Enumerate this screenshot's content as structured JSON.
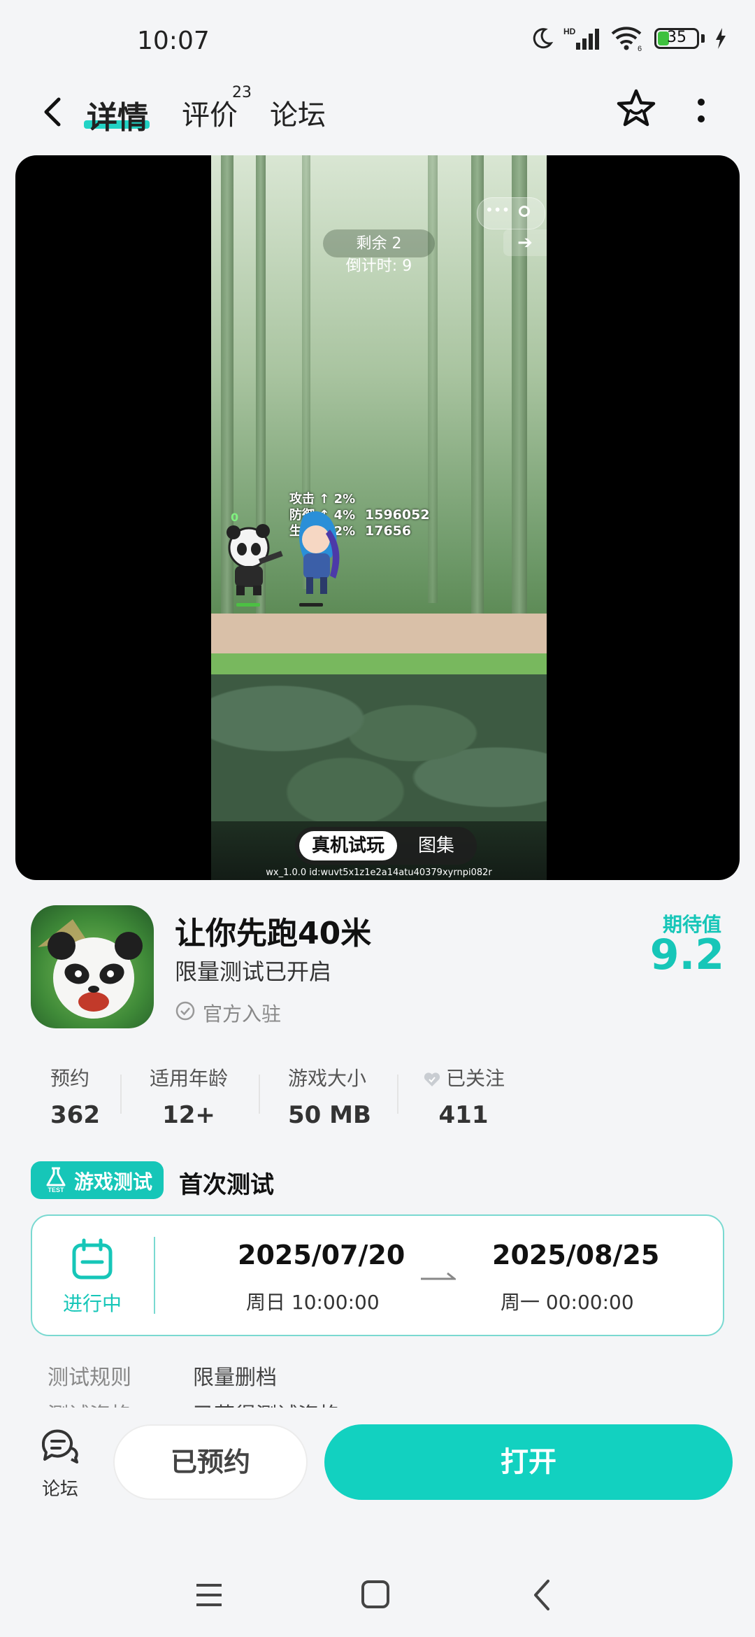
{
  "status_bar": {
    "time": "10:07",
    "battery": "35",
    "battery_level": 0.35,
    "network": "HD",
    "wifi_sub": "6"
  },
  "nav": {
    "tabs": [
      {
        "label": "详情",
        "active": true
      },
      {
        "label": "评价",
        "badge": "23"
      },
      {
        "label": "论坛"
      }
    ]
  },
  "media": {
    "hud_remaining": "剩余 2",
    "hud_countdown": "倒计时: 9",
    "stats": [
      "攻击 ↑ 2%",
      "防御 ↑ 4%",
      "生命 ↑ 2%"
    ],
    "power_values": [
      "1596052",
      "17656"
    ],
    "player_level": "0",
    "toggle_trial": "真机试玩",
    "toggle_gallery": "图集",
    "build_id": "wx_1.0.0 id:wuvt5x1z1e2a14atu40379xyrnpi082r"
  },
  "app": {
    "name": "让你先跑40米",
    "subtitle": "限量测试已开启",
    "verified": "官方入驻",
    "expect_label": "期待值",
    "expect_score": "9.2"
  },
  "meta": [
    {
      "label": "预约",
      "value": "362"
    },
    {
      "label": "适用年龄",
      "value": "12+"
    },
    {
      "label": "游戏大小",
      "value": "50 MB"
    },
    {
      "label": "已关注",
      "value": "411"
    }
  ],
  "test": {
    "badge": "游戏测试",
    "badge_icon_text": "TEST",
    "title": "首次测试",
    "status": "进行中",
    "start_date": "2025/07/20",
    "start_time": "周日  10:00:00",
    "end_date": "2025/08/25",
    "end_time": "周一  00:00:00",
    "rules": [
      {
        "label": "测试规则",
        "value": "限量删档"
      },
      {
        "label": "测试资格",
        "value": "已获得测试资格"
      }
    ]
  },
  "actions": {
    "forum_label": "论坛",
    "reserved_label": "已预约",
    "open_label": "打开"
  },
  "colors": {
    "accent": "#16c6b8",
    "open_button": "#12d1c0",
    "background": "#f4f5f7"
  }
}
